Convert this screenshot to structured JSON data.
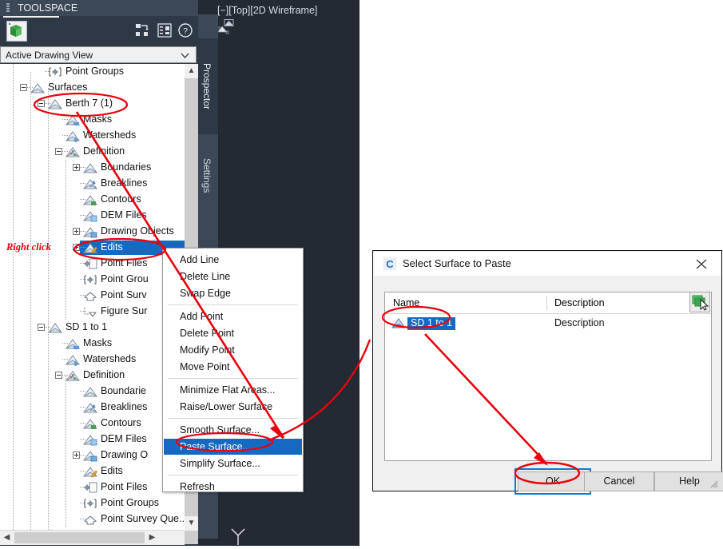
{
  "palette": {
    "title": "TOOLSPACE",
    "grip_icon": "grip-dots-icon",
    "doc_icon": "drawing-document-icon",
    "toolbar_icons": [
      "expand-tree-icon",
      "item-view-icon",
      "help-icon"
    ],
    "view_selector": {
      "value": "Active Drawing View",
      "chevron": "chevron-down-icon"
    }
  },
  "vtabs": {
    "prospector": "Prospector",
    "settings": "Settings"
  },
  "cad": {
    "viewport_label": "[−][Top][2D Wireframe]",
    "surface_glyph": "surface-object-icon",
    "ucs_icon": "ucs-axis-icon",
    "background_color": "#232a33"
  },
  "tree": {
    "nodes": [
      {
        "label": "Point Groups",
        "icon": "point-group-icon",
        "indent": 1,
        "expander": "none"
      },
      {
        "label": "Surfaces",
        "icon": "surface-icon",
        "indent": 0,
        "expander": "minus"
      },
      {
        "label": "Berth 7 (1)",
        "icon": "surface-icon",
        "indent": 1,
        "expander": "minus"
      },
      {
        "label": "Masks",
        "icon": "mask-icon",
        "indent": 2,
        "expander": "none"
      },
      {
        "label": "Watersheds",
        "icon": "watershed-icon",
        "indent": 2,
        "expander": "none"
      },
      {
        "label": "Definition",
        "icon": "definition-icon",
        "indent": 2,
        "expander": "minus"
      },
      {
        "label": "Boundaries",
        "icon": "boundary-icon",
        "indent": 3,
        "expander": "plus"
      },
      {
        "label": "Breaklines",
        "icon": "breakline-icon",
        "indent": 3,
        "expander": "none"
      },
      {
        "label": "Contours",
        "icon": "contour-icon",
        "indent": 3,
        "expander": "none"
      },
      {
        "label": "DEM Files",
        "icon": "dem-file-icon",
        "indent": 3,
        "expander": "none"
      },
      {
        "label": "Drawing Objects",
        "icon": "drawing-object-icon",
        "indent": 3,
        "expander": "plus"
      },
      {
        "label": "Edits",
        "icon": "edits-icon",
        "indent": 3,
        "expander": "plus",
        "selected": true
      },
      {
        "label": "Point Files",
        "icon": "point-file-icon",
        "indent": 3,
        "expander": "none"
      },
      {
        "label": "Point Grou",
        "icon": "point-group-icon",
        "indent": 3,
        "expander": "none"
      },
      {
        "label": "Point Surv",
        "icon": "point-survey-icon",
        "indent": 3,
        "expander": "none"
      },
      {
        "label": "Figure Sur",
        "icon": "figure-survey-icon",
        "indent": 3,
        "expander": "none"
      },
      {
        "label": "SD 1 to 1",
        "icon": "surface-icon",
        "indent": 1,
        "expander": "minus"
      },
      {
        "label": "Masks",
        "icon": "mask-icon",
        "indent": 2,
        "expander": "none"
      },
      {
        "label": "Watersheds",
        "icon": "watershed-icon",
        "indent": 2,
        "expander": "none"
      },
      {
        "label": "Definition",
        "icon": "definition-icon",
        "indent": 2,
        "expander": "minus"
      },
      {
        "label": "Boundarie",
        "icon": "boundary-icon",
        "indent": 3,
        "expander": "none"
      },
      {
        "label": "Breaklines",
        "icon": "breakline-icon",
        "indent": 3,
        "expander": "none"
      },
      {
        "label": "Contours",
        "icon": "contour-icon",
        "indent": 3,
        "expander": "none"
      },
      {
        "label": "DEM Files",
        "icon": "dem-file-icon",
        "indent": 3,
        "expander": "none"
      },
      {
        "label": "Drawing O",
        "icon": "drawing-object-icon",
        "indent": 3,
        "expander": "plus"
      },
      {
        "label": "Edits",
        "icon": "edits-icon",
        "indent": 3,
        "expander": "none"
      },
      {
        "label": "Point Files",
        "icon": "point-file-icon",
        "indent": 3,
        "expander": "none"
      },
      {
        "label": "Point Groups",
        "icon": "point-group-icon",
        "indent": 3,
        "expander": "none"
      },
      {
        "label": "Point Survey Que...",
        "icon": "point-survey-icon",
        "indent": 3,
        "expander": "none"
      }
    ],
    "selection_color": "#1669c1",
    "scroll_up_icon": "scroll-up-icon",
    "scroll_down_icon": "scroll-down-icon",
    "scroll_left_icon": "scroll-left-icon",
    "scroll_right_icon": "scroll-right-icon"
  },
  "context_menu": {
    "items": [
      {
        "label": "Add Line"
      },
      {
        "label": "Delete Line"
      },
      {
        "label": "Swap Edge"
      },
      {
        "separator": true
      },
      {
        "label": "Add Point"
      },
      {
        "label": "Delete Point"
      },
      {
        "label": "Modify Point"
      },
      {
        "label": "Move Point"
      },
      {
        "separator": true
      },
      {
        "label": "Minimize Flat Areas..."
      },
      {
        "label": "Raise/Lower Surface"
      },
      {
        "separator": true
      },
      {
        "label": "Smooth Surface..."
      },
      {
        "label": "Paste Surface...",
        "highlighted": true
      },
      {
        "label": "Simplify Surface..."
      },
      {
        "separator": true
      },
      {
        "label": "Refresh"
      }
    ],
    "highlight_color": "#1669c1"
  },
  "dialog": {
    "title": "Select Surface to Paste",
    "app_icon": "civil3d-icon",
    "close_icon": "close-icon",
    "columns": [
      "Name",
      "Description"
    ],
    "rows": [
      {
        "name": "SD 1 to 1",
        "description": "Description",
        "icon": "surface-icon",
        "selected": true
      }
    ],
    "pick_button_icon": "pick-from-screen-icon",
    "buttons": {
      "ok": "OK",
      "cancel": "Cancel",
      "help": "Help"
    },
    "focus_color": "#0b7ad1",
    "resize_grip_icon": "resize-grip-icon"
  },
  "annotations": {
    "right_click_label": "Right click",
    "color": "#e8000d",
    "ellipses": [
      "berth-7-node",
      "edits-node",
      "paste-surface-item",
      "sd-1-to-1-row",
      "ok-button"
    ],
    "arrows": [
      "berth7-to-paste-surface",
      "sd1to1-row-to-ok"
    ]
  }
}
